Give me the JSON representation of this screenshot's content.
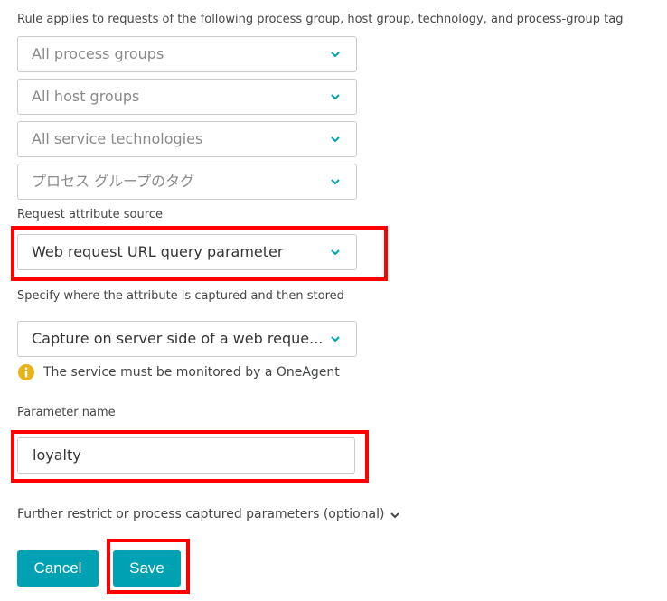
{
  "rule_text": "Rule applies to requests of the following process group, host group, technology, and process-group tag",
  "filters": [
    {
      "placeholder": "All process groups"
    },
    {
      "placeholder": "All host groups"
    },
    {
      "placeholder": "All service technologies"
    },
    {
      "placeholder": "プロセス グループのタグ"
    }
  ],
  "source": {
    "label": "Request attribute source",
    "value": "Web request URL query parameter"
  },
  "capture": {
    "label": "Specify where the attribute is captured and then stored",
    "value": "Capture on server side of a web reque..."
  },
  "info": {
    "icon": "info-icon",
    "text": "The service must be monitored by a OneAgent"
  },
  "parameter": {
    "label": "Parameter name",
    "value": "loyalty"
  },
  "further": {
    "label": "Further restrict or process captured parameters (optional)"
  },
  "buttons": {
    "cancel": "Cancel",
    "save": "Save"
  },
  "colors": {
    "accent": "#00a1b2",
    "chevron": "#00a1b2",
    "info": "#e7b416",
    "highlight": "#ff0000"
  }
}
